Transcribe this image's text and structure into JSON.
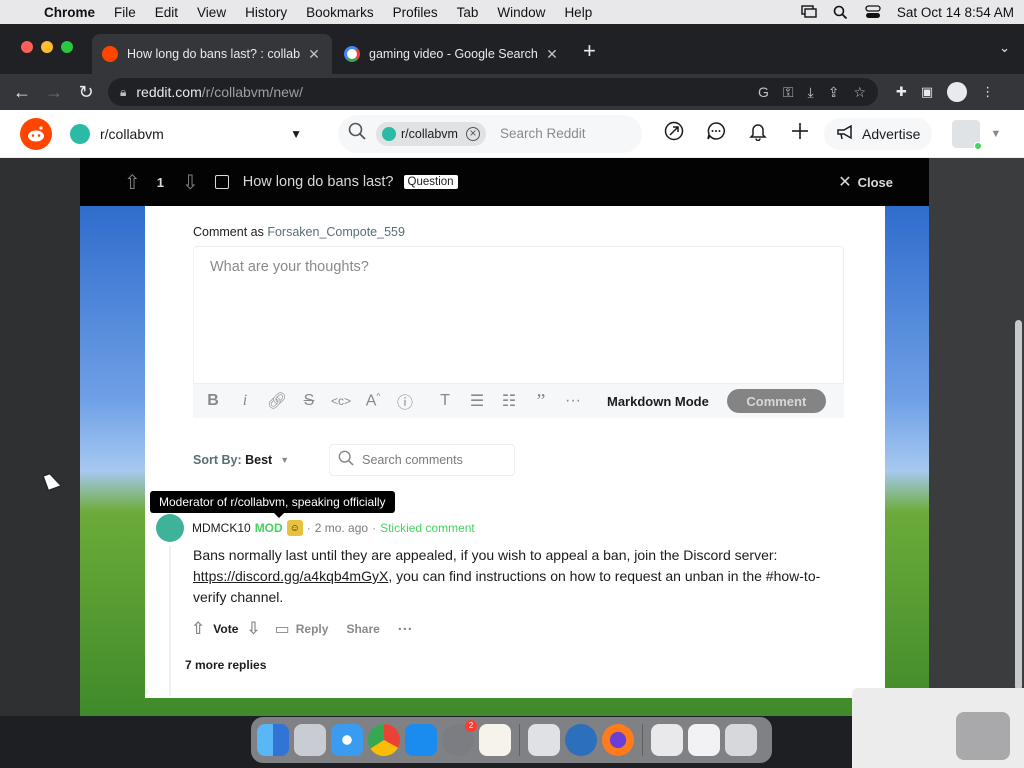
{
  "menubar": {
    "app_name": "Chrome",
    "items": [
      "File",
      "Edit",
      "View",
      "History",
      "Bookmarks",
      "Profiles",
      "Tab",
      "Window",
      "Help"
    ],
    "datetime": "Sat Oct 14  8:54 AM"
  },
  "browser": {
    "tabs": [
      {
        "title": "How long do bans last? : collab",
        "active": true,
        "favicon": "reddit-icon"
      },
      {
        "title": "gaming video - Google Search",
        "active": false,
        "favicon": "google-icon"
      }
    ],
    "url_host": "reddit.com",
    "url_path": "/r/collabvm/new/"
  },
  "reddit_header": {
    "subreddit": "r/collabvm",
    "search_chip": "r/collabvm",
    "search_placeholder": "Search Reddit",
    "advertise_label": "Advertise"
  },
  "post_bar": {
    "score": "1",
    "title": "How long do bans last?",
    "flair": "Question",
    "close_label": "Close"
  },
  "comment_box": {
    "comment_as_label": "Comment as",
    "username": "Forsaken_Compote_559",
    "placeholder": "What are your thoughts?",
    "markdown_mode_label": "Markdown Mode",
    "comment_button_label": "Comment"
  },
  "sort": {
    "label": "Sort By:",
    "value": "Best",
    "search_placeholder": "Search comments"
  },
  "tooltip": "Moderator of r/collabvm, speaking officially",
  "comment": {
    "author": "MDMCK10",
    "mod_label": "MOD",
    "time": "2 mo. ago",
    "sticky": "Stickied comment",
    "body_before_link": "Bans normally last until they are appealed, if you wish to appeal a ban, join the Discord server: ",
    "link_text": "https://discord.gg/a4kqb4mGyX",
    "body_after_link": ", you can find instructions on how to request an unban in the #how-to-verify channel.",
    "vote_label": "Vote",
    "reply_label": "Reply",
    "share_label": "Share"
  },
  "more_replies": "7 more replies",
  "dock": {
    "badge_count": "2"
  },
  "colors": {
    "reddit_orange": "#ff4500",
    "mod_green": "#46d160",
    "modal_bar": "#030303",
    "chrome_dark": "#202124"
  }
}
